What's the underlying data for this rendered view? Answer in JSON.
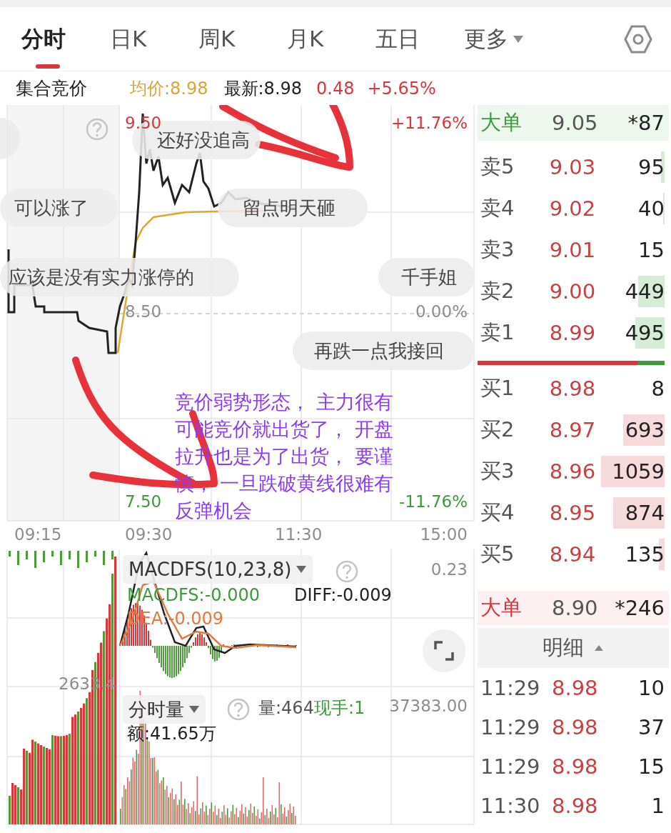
{
  "tabs": [
    {
      "label": "分时",
      "selected": true,
      "kind": "tab"
    },
    {
      "label": "日K",
      "selected": false,
      "kind": "tab"
    },
    {
      "label": "周K",
      "selected": false,
      "kind": "tab"
    },
    {
      "label": "月K",
      "selected": false,
      "kind": "tab"
    },
    {
      "label": "五日",
      "selected": false,
      "kind": "tab"
    },
    {
      "label": "更多",
      "selected": false,
      "kind": "dropdown"
    }
  ],
  "quote_bar": {
    "title": "集合竞价",
    "average": "均价:8.98",
    "latest": "最新:8.98",
    "change": "0.48",
    "change_percent": "+5.65%"
  },
  "price_chart": {
    "high_price": "9.50",
    "high_percent": "+11.76%",
    "mid_price": "8.50",
    "mid_percent": "0.00%",
    "low_price": "7.50",
    "low_percent": "-11.76%",
    "time_axis": [
      "09:15",
      "09:30",
      "11:30",
      "15:00"
    ]
  },
  "comments": [
    "还好没追高",
    "可以涨了",
    "留点明天砸",
    "应该是没有实力涨停的",
    "千手姐",
    "再跌一点我接回"
  ],
  "annotation": "竞价弱势形态， 主力很有可能竞价就出货了， 开盘拉升也是为了出货， 要谨慎， 一旦跌破黄线很难有反弹机会",
  "macd": {
    "indicator": "MACDFS(10,23,8)",
    "scale": "0.23",
    "macdfs": "MACDFS:-0.000",
    "diff": "DIFF:-0.009",
    "dea": "DEA:-0.009"
  },
  "volume": {
    "indicator": "分时量",
    "pre_scale": "2633.4",
    "volume": "量:464",
    "current_hand": "现手:1",
    "scale": "37383.00",
    "amount": "额:41.65万"
  },
  "order_book": {
    "big_top": {
      "label": "大单",
      "price": "9.05",
      "qty": "*87",
      "kind": "sell"
    },
    "asks": [
      {
        "label": "卖5",
        "price": "9.03",
        "qty": "95"
      },
      {
        "label": "卖4",
        "price": "9.02",
        "qty": "40"
      },
      {
        "label": "卖3",
        "price": "9.01",
        "qty": "15"
      },
      {
        "label": "卖2",
        "price": "9.00",
        "qty": "449"
      },
      {
        "label": "卖1",
        "price": "8.99",
        "qty": "495"
      }
    ],
    "ratio": {
      "level": 0.86
    },
    "bids": [
      {
        "label": "买1",
        "price": "8.98",
        "qty": "8"
      },
      {
        "label": "买2",
        "price": "8.97",
        "qty": "693"
      },
      {
        "label": "买3",
        "price": "8.96",
        "qty": "1059"
      },
      {
        "label": "买4",
        "price": "8.95",
        "qty": "874"
      },
      {
        "label": "买5",
        "price": "8.94",
        "qty": "135"
      }
    ],
    "big_bottom": {
      "label": "大单",
      "price": "8.90",
      "qty": "*246",
      "kind": "buy"
    }
  },
  "trades": {
    "header": "明细",
    "rows": [
      {
        "time": "11:29",
        "price": "8.98",
        "qty": "10"
      },
      {
        "time": "11:29",
        "price": "8.98",
        "qty": "37"
      },
      {
        "time": "11:29",
        "price": "8.98",
        "qty": "15"
      },
      {
        "time": "11:30",
        "price": "8.98",
        "qty": "1"
      }
    ]
  }
}
